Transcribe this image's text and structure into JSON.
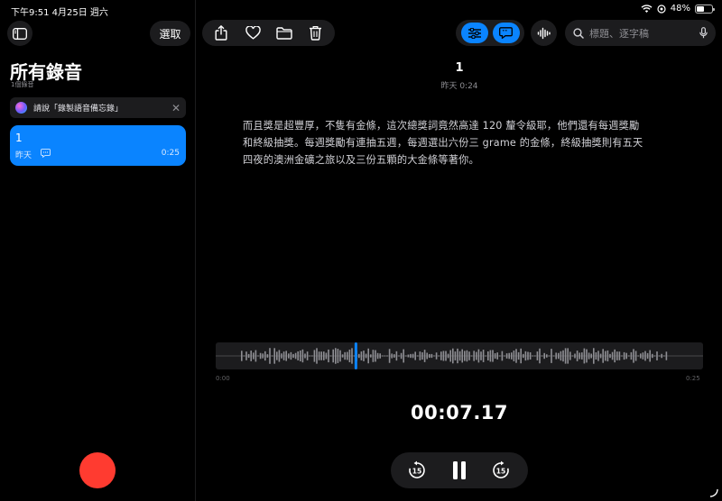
{
  "status_bar": {
    "time_date": "下午9:51  4月25日 週六",
    "battery": "48%",
    "battery_level": 0.48
  },
  "sidebar": {
    "select_label": "選取",
    "title": "所有錄音",
    "count": "1個錄音",
    "siri_tip": "請說「錄製語音備忘錄」",
    "recordings": [
      {
        "name": "1",
        "date": "昨天",
        "duration": "0:25"
      }
    ]
  },
  "main": {
    "search_placeholder": "標題、逐字稿",
    "recording_title": "1",
    "recording_meta": "昨天  0:24",
    "transcript": "而且獎是超豐厚，不隻有金條，這次總獎詞竟然高達 120 釐令級耶，他們還有每週獎勵和終級抽獎。每週獎勵有連抽五週，每週選出六份三 grame 的金條，終級抽獎則有五天四夜的澳洲金礦之旅以及三份五顆的大金條等著你。",
    "timeline_start": "0:00",
    "timeline_end": "0:25",
    "current_time": "00:07.17",
    "playhead_seconds": 7.17,
    "duration_seconds": 25,
    "skip_back_label": "15",
    "skip_forward_label": "15"
  },
  "colors": {
    "accent": "#0a84ff",
    "record": "#ff3b30",
    "panel": "#1c1c1e"
  }
}
